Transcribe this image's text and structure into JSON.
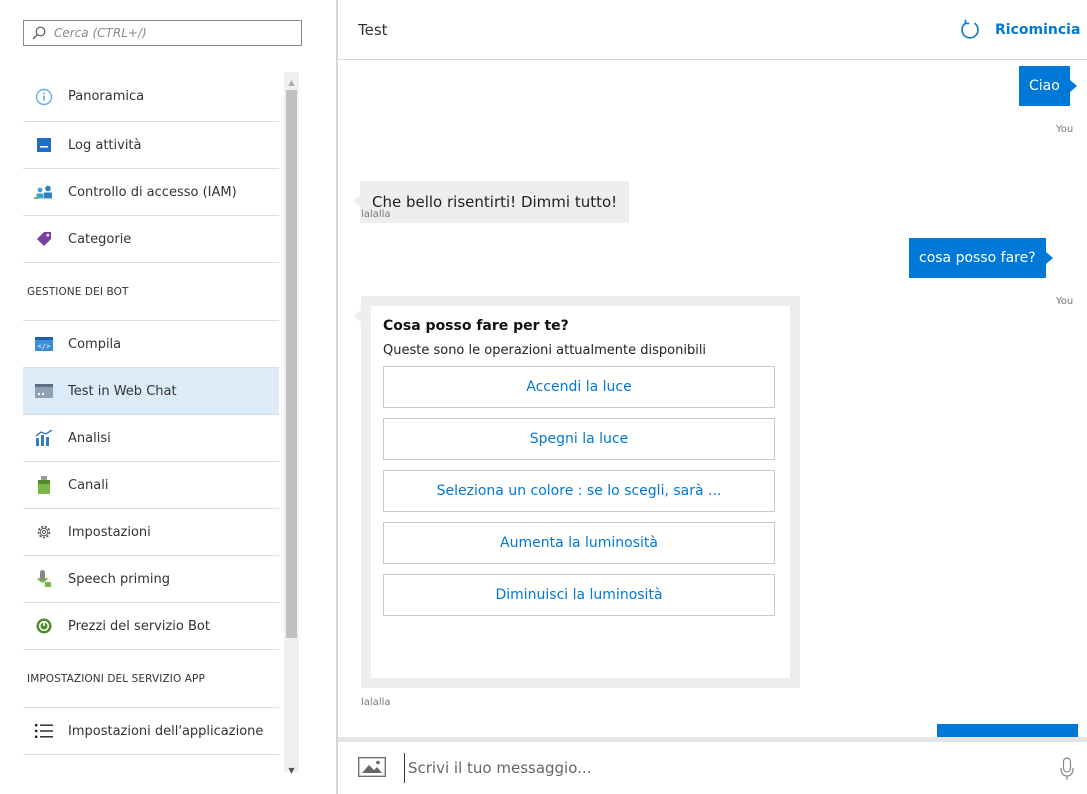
{
  "sidebar": {
    "search_placeholder": "Cerca (CTRL+/)",
    "items": [
      {
        "label": "Panoramica",
        "icon": "info-icon"
      },
      {
        "label": "Log attività",
        "icon": "log-icon"
      },
      {
        "label": "Controllo di accesso (IAM)",
        "icon": "users-icon"
      },
      {
        "label": "Categorie",
        "icon": "tag-icon"
      }
    ],
    "section_bot": "GESTIONE DEI BOT",
    "bot_items": [
      {
        "label": "Compila",
        "icon": "code-icon"
      },
      {
        "label": "Test in Web Chat",
        "icon": "webchat-icon"
      },
      {
        "label": "Analisi",
        "icon": "analytics-icon"
      },
      {
        "label": "Canali",
        "icon": "channels-icon"
      },
      {
        "label": "Impostazioni",
        "icon": "gear-icon"
      },
      {
        "label": "Speech priming",
        "icon": "speech-icon"
      },
      {
        "label": "Prezzi del servizio Bot",
        "icon": "pricing-icon"
      }
    ],
    "section_app": "IMPOSTAZIONI DEL SERVIZIO APP",
    "app_items": [
      {
        "label": "Impostazioni dell'applicazione",
        "icon": "list-icon"
      }
    ]
  },
  "chat": {
    "title": "Test",
    "restart_label": "Ricomincia",
    "messages": [
      {
        "from": "user",
        "text": "Ciao",
        "meta": "You"
      },
      {
        "from": "bot",
        "text": "Che bello risentirti! Dimmi tutto!",
        "meta": "lalalla"
      },
      {
        "from": "user",
        "text": "cosa posso fare?",
        "meta": "You"
      }
    ],
    "card": {
      "title": "Cosa posso fare per te?",
      "text": "Queste sono le operazioni attualmente disponibili",
      "buttons": [
        "Accendi la luce",
        "Spegni la luce",
        "Seleziona un colore : se lo scegli, sarà ...",
        "Aumenta la luminosità",
        "Diminuisci la luminosità"
      ],
      "meta": "lalalla"
    },
    "input_placeholder": "Scrivi il tuo messaggio..."
  },
  "colors": {
    "accent": "#0078d7",
    "bot_bubble": "#eceef0",
    "active_item": "#dcebf8"
  }
}
